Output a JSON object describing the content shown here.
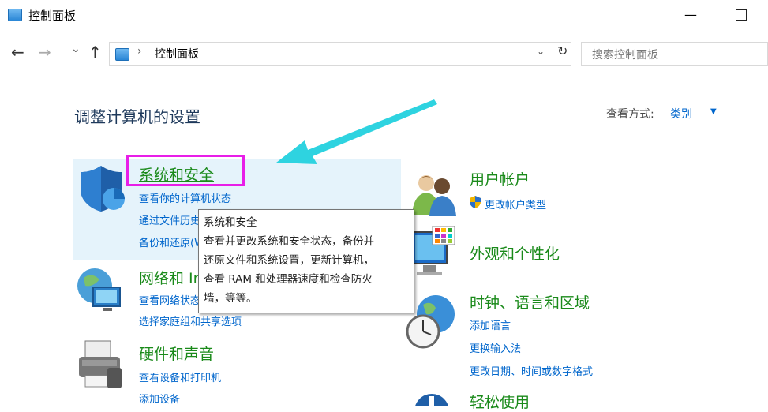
{
  "window": {
    "title": "控制面板",
    "minimize": "—"
  },
  "nav": {
    "back": "←",
    "forward": "→",
    "recent": "⌄",
    "up": "↑",
    "address": "控制面板",
    "address_sep": "›",
    "address_drop": "⌄",
    "refresh": "↻",
    "search_placeholder": "搜索控制面板"
  },
  "main": {
    "heading": "调整计算机的设置",
    "view_by_label": "查看方式:",
    "view_by_value": "类别"
  },
  "categories": {
    "system_security": {
      "title": "系统和安全",
      "links": [
        "查看你的计算机状态",
        "通过文件历史记录保存你的文件备份副本",
        "备份和还原(Windows 7)"
      ]
    },
    "network": {
      "title": "网络和 Internet",
      "links": [
        "查看网络状态和任务",
        "选择家庭组和共享选项"
      ]
    },
    "hardware": {
      "title": "硬件和声音",
      "links": [
        "查看设备和打印机",
        "添加设备"
      ]
    },
    "user_accounts": {
      "title": "用户帐户",
      "links": [
        "更改帐户类型"
      ]
    },
    "appearance": {
      "title": "外观和个性化"
    },
    "clock": {
      "title": "时钟、语言和区域",
      "links": [
        "添加语言",
        "更换输入法",
        "更改日期、时间或数字格式"
      ]
    },
    "ease": {
      "title": "轻松使用"
    }
  },
  "tooltip": {
    "title": "系统和安全",
    "lines": [
      "查看并更改系统和安全状态，备份并",
      "还原文件和系统设置，更新计算机，",
      "查看 RAM 和处理器速度和检查防火",
      "墙，等等。"
    ]
  },
  "colors": {
    "category_green": "#1a8a1a",
    "link_blue": "#0066cc",
    "highlight_box": "#e81ee8",
    "arrow": "#2ed3e0",
    "hover_bg": "#e5f3fb"
  }
}
